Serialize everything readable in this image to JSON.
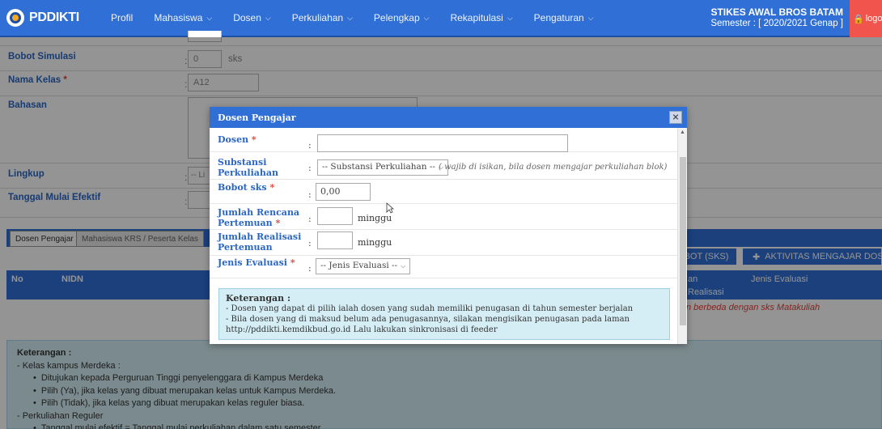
{
  "brand": "PDDIKTI",
  "nav": [
    "Profil",
    "Mahasiswa",
    "Dosen",
    "Perkuliahan",
    "Pelengkap",
    "Rekapitulasi",
    "Pengaturan"
  ],
  "institution": "STIKES AWAL BROS BATAM",
  "semester": "Semester : [ 2020/2021 Genap ]",
  "logout": "logout",
  "bg_form": {
    "bobot_simulasi_label": "Bobot Simulasi",
    "bobot_simulasi_value": "0",
    "sks": "sks",
    "nama_kelas_label": "Nama Kelas",
    "nama_kelas_value": "A12",
    "bahasan_label": "Bahasan",
    "lingkup_label": "Lingkup",
    "lingkup_value": "-- Li",
    "tanggal_label": "Tanggal Mulai Efektif"
  },
  "tabs": [
    "Dosen Pengajar",
    "Mahasiswa KRS / Peserta Kelas"
  ],
  "buttons": {
    "bobot": "BOT (SKS)",
    "aktivitas": "AKTIVITAS MENGAJAR DOSEN"
  },
  "table_head": {
    "no": "No",
    "nidn": "NIDN",
    "an": "an",
    "realisasi": "Realisasi",
    "jenis_evaluasi": "Jenis Evaluasi"
  },
  "table_warning": "n berbeda dengan sks Matakuliah",
  "keterangan": {
    "title": "Keterangan :",
    "l1": "- Kelas kampus Merdeka :",
    "l2": "Ditujukan kepada Perguruan Tinggi penyelenggara di Kampus Merdeka",
    "l3": "Pilih (Ya), jika kelas yang dibuat merupakan kelas untuk Kampus Merdeka.",
    "l4": "Pilih (Tidak), jika kelas yang dibuat merupakan kelas reguler biasa.",
    "l5": "- Perkuliahan Reguler",
    "l6": "Tanggal mulai efektif = Tanggal mulai perkuliahan dalam satu semester"
  },
  "modal": {
    "title": "Dosen Pengajar",
    "close": "×",
    "dosen_label": "Dosen",
    "substansi_label_1": "Substansi",
    "substansi_label_2": "Perkuliahan",
    "substansi_select": "-- Substansi Perkuliahan --",
    "substansi_hint": "( wajib di isikan, bila dosen mengajar perkuliahan blok)",
    "bobot_label": "Bobot sks",
    "bobot_value": "0,00",
    "rencana_label_1": "Jumlah Rencana",
    "rencana_label_2": "Pertemuan",
    "realisasi_label_1": "Jumlah Realisasi",
    "realisasi_label_2": "Pertemuan",
    "minggu": "minggu",
    "jenis_label": "Jenis Evaluasi",
    "jenis_select": "-- Jenis Evaluasi --",
    "ket_title": "Keterangan :",
    "ket_1": "- Dosen yang dapat di pilih ialah dosen yang sudah memiliki penugasan di tahun semester berjalan",
    "ket_2": "- Bila dosen yang di maksud belum ada penugasannya, silakan mengisikan penugasan pada laman",
    "ket_3": "http://pddikti.kemdikbud.go.id Lalu lakukan sinkronisasi di feeder"
  }
}
